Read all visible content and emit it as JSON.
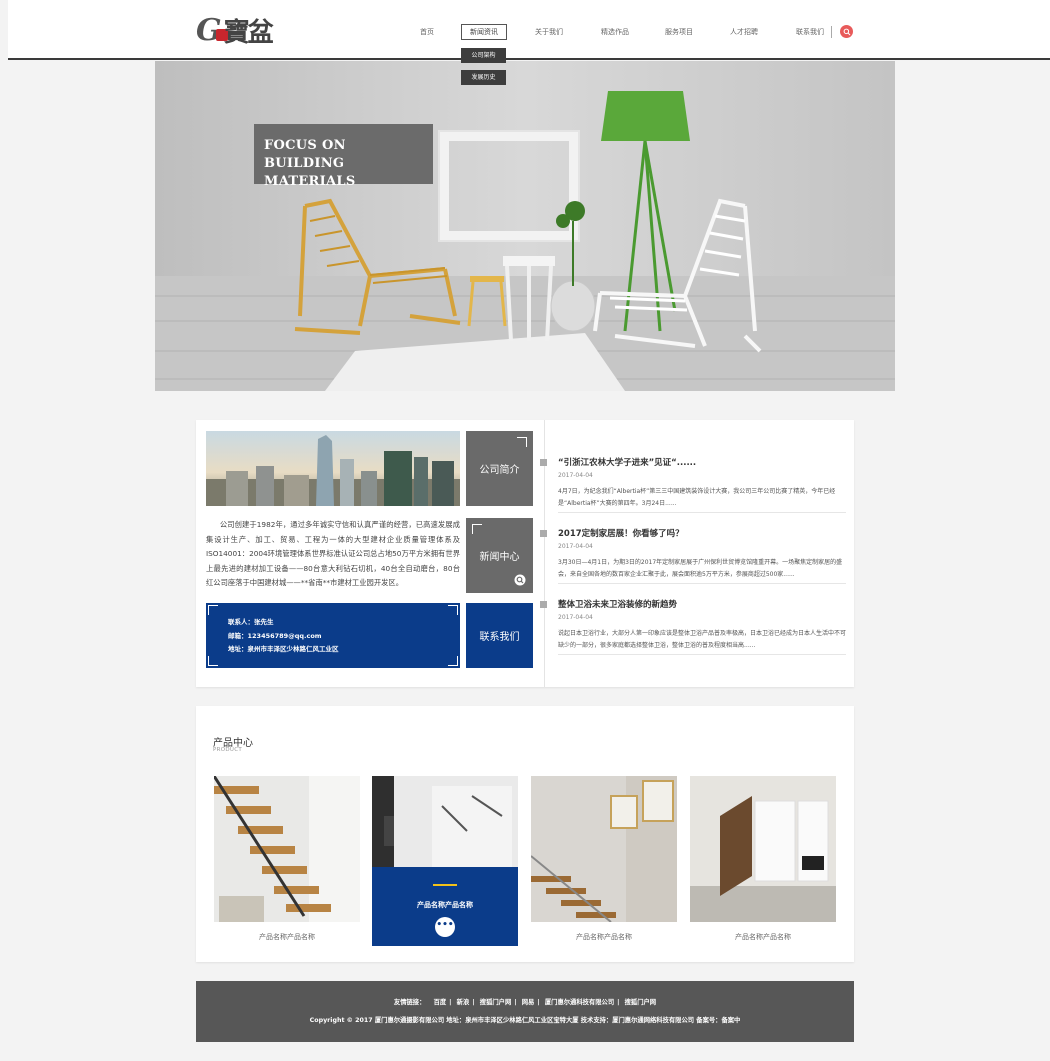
{
  "header": {
    "logo": {
      "letter": "G",
      "text": "寶盆"
    },
    "nav": [
      "首页",
      "新闻资讯",
      "关于我们",
      "精选作品",
      "服务项目",
      "人才招聘",
      "联系我们"
    ],
    "active_index": 1,
    "dropdown": [
      "公司架构",
      "发展历史"
    ]
  },
  "banner": {
    "line1": "FOCUS ON",
    "line2": "BUILDING MATERIALS"
  },
  "about": {
    "company_intro_label": "公司简介",
    "news_center_label": "新闻中心",
    "contact_us_label": "联系我们",
    "text": "公司创建于1982年，通过多年诚实守信和认真严谨的经营，已高速发展成集设计生产、加工、贸易、工程为一体的大型建材企业质量管理体系及ISO14001：2004环境管理体系世界标准认证公司总占地50万平方米拥有世界上最先进的建材加工设备——80台意大利钻石切机，40台全自动磨台，80台红公司座落于中国建材城——**省南**市建材工业园开发区。",
    "contact": {
      "person": "联系人：张先生",
      "email": "邮箱：123456789@qq.com",
      "address": "地址：泉州市丰泽区少林路仁风工业区"
    }
  },
  "news": [
    {
      "title": "“引浙江农林大学子进来”见证“......",
      "date": "2017-04-04",
      "desc": "4月7日，为纪念我们“Albertia杯”第三三中国建筑装饰设计大赛，我公司三年公司比赛了精英，今年已经是“Albertia杯”大赛的第四年。3月24日......"
    },
    {
      "title": "2017定制家居展！你看够了吗？",
      "date": "2017-04-04",
      "desc": "3月30日—4月1日，为期3日的2017年定制家居展于广州保利世贸博览馆隆重开幕。一场聚焦定制家居的盛会，来自全国各地的数百家企业汇聚于此，展会面积逾5万平方米，参展商超过500家......"
    },
    {
      "title": "整体卫浴未来卫浴装修的新趋势",
      "date": "2017-04-04",
      "desc": "说起日本卫浴行业，大部分人第一印象应该是整体卫浴产品普及率极高，日本卫浴已经成为日本人生活中不可缺少的一部分，很多家庭都选择整体卫浴，整体卫浴的普及程度相当高......"
    }
  ],
  "products": {
    "title": "产品中心",
    "subtitle": "PRODUCT",
    "items": [
      {
        "name": "产品名称产品名称"
      },
      {
        "name": "产品名称产品名称"
      },
      {
        "name": "产品名称产品名称"
      },
      {
        "name": "产品名称产品名称"
      }
    ],
    "more_glyph": "•••"
  },
  "footer": {
    "links_label": "友情链接：",
    "links": [
      "百度",
      "新浪",
      "搜狐门户网",
      "网易",
      "厦门惠尔通科技有限公司",
      "搜狐门户网"
    ],
    "copyright": "Copyright © 2017 厦门惠尔通摄影有限公司 地址：泉州市丰泽区少林路仁风工业区宝特大厦  技术支持：厦门惠尔通网络科技有限公司 备案号：备案中"
  },
  "colors": {
    "accent_blue": "#0b3c8a",
    "tile_gray": "#6a6a6a",
    "footer_gray": "#575757",
    "highlight_yellow": "#f3c21a",
    "search_red": "#e85a5a"
  }
}
